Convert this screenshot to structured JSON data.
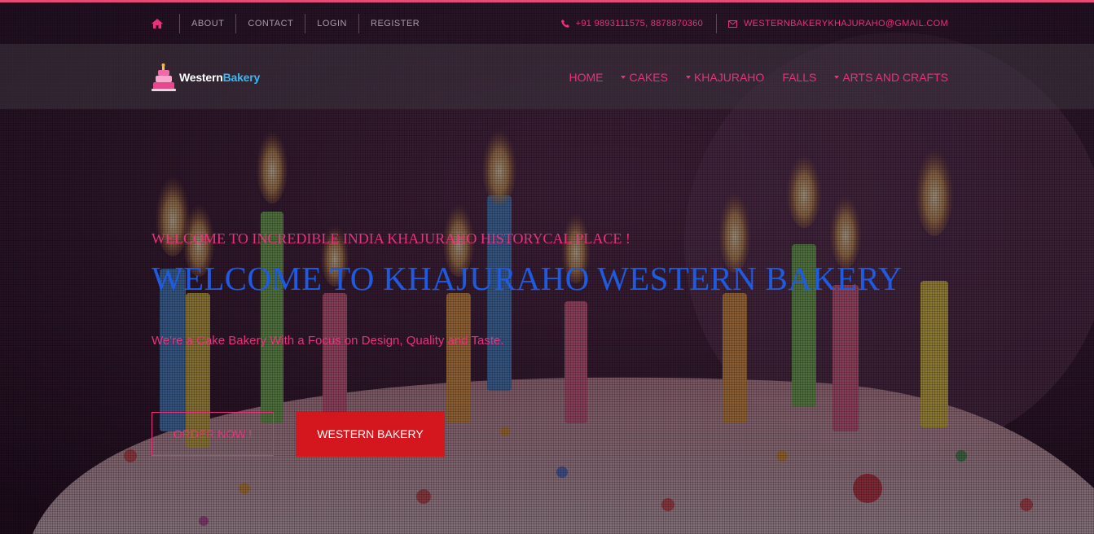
{
  "topbar": {
    "links": [
      "ABOUT",
      "CONTACT",
      "LOGIN",
      "REGISTER"
    ],
    "phone": "+91 9893111575, 8878870360",
    "email": "WESTERNBAKERYKHAJURAHO@GMAIL.COM",
    "icons": {
      "home": "home-icon",
      "phone": "phone-icon",
      "email": "envelope-icon"
    }
  },
  "logo": {
    "part1": "Western",
    "part2": "Bakery"
  },
  "nav": {
    "items": [
      {
        "label": "HOME",
        "dropdown": false
      },
      {
        "label": "CAKES",
        "dropdown": true
      },
      {
        "label": "KHAJURAHO",
        "dropdown": true
      },
      {
        "label": "FALLS",
        "dropdown": false
      },
      {
        "label": "ARTS AND CRAFTS",
        "dropdown": true
      }
    ]
  },
  "hero": {
    "eyebrow": "WELCOME TO INCREDIBLE INDIA KHAJURAHO HISTORYCAL PLACE !",
    "headline": "WELCOME TO KHAJURAHO WESTERN BAKERY",
    "tagline": "We're a Cake Bakery With a Focus on Design, Quality and Taste.",
    "primary_button": "ORDER NOW !",
    "secondary_button": "WESTERN BAKERY"
  },
  "colors": {
    "accent": "#e8317a",
    "headline": "#1e5be0",
    "button_red": "#d4171e",
    "logo_blue": "#3fb6f0"
  }
}
